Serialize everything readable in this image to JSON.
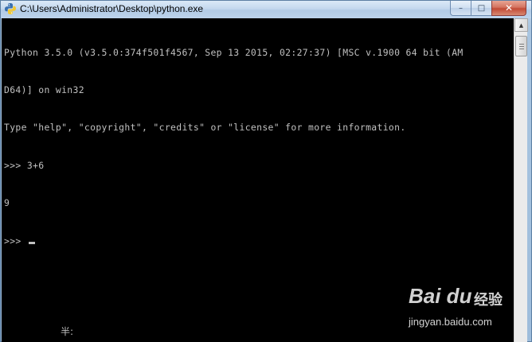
{
  "window": {
    "title": "C:\\Users\\Administrator\\Desktop\\python.exe",
    "controls": {
      "minimize": "–",
      "maximize": "□",
      "close": "✕"
    }
  },
  "console": {
    "lines": [
      "Python 3.5.0 (v3.5.0:374f501f4567, Sep 13 2015, 02:27:37) [MSC v.1900 64 bit (AM",
      "D64)] on win32",
      "Type \"help\", \"copyright\", \"credits\" or \"license\" for more information.",
      ">>> 3+6",
      "9"
    ],
    "prompt": ">>> ",
    "ime_indicator": "半:"
  },
  "scrollbar": {
    "up_arrow": "▲"
  },
  "watermark": {
    "logo": "Bai du",
    "sub": "经验",
    "url": "jingyan.baidu.com"
  },
  "icons": {
    "app": "python-icon"
  }
}
